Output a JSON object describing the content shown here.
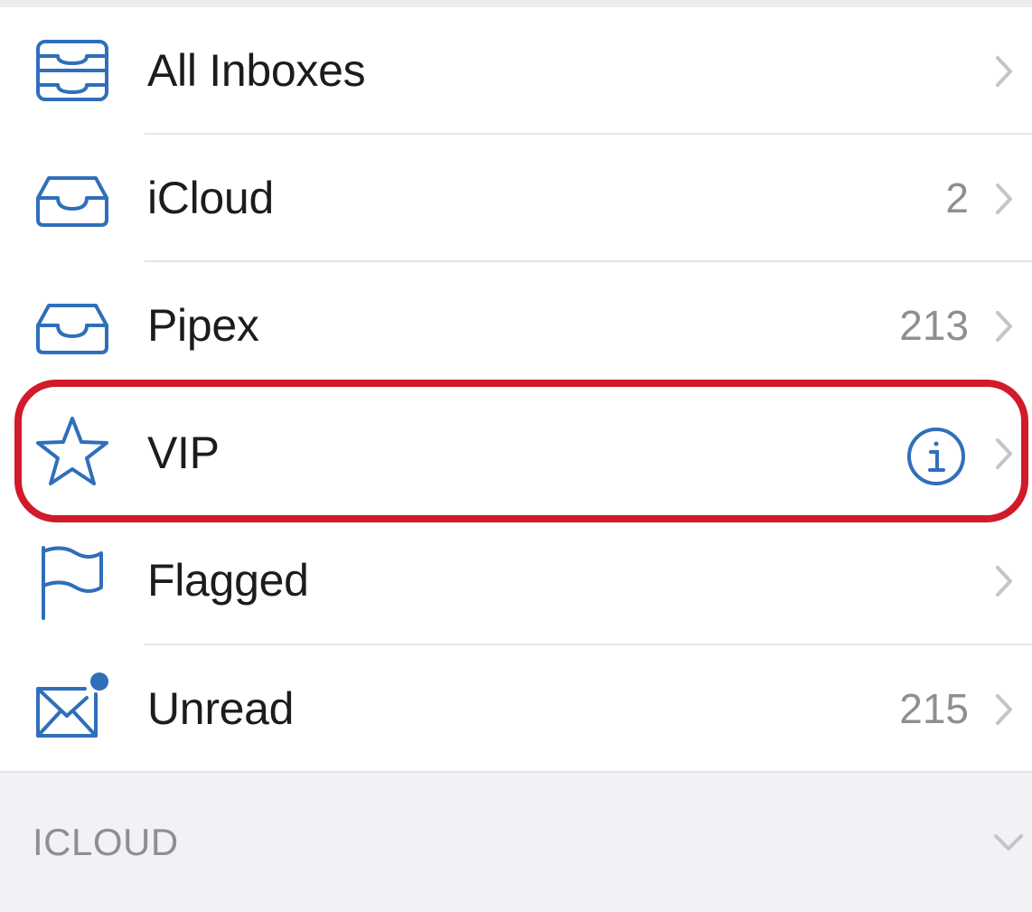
{
  "mailboxes": [
    {
      "label": "All Inboxes",
      "count": "",
      "icon": "all-inboxes-icon"
    },
    {
      "label": "iCloud",
      "count": "2",
      "icon": "inbox-tray-icon"
    },
    {
      "label": "Pipex",
      "count": "213",
      "icon": "inbox-tray-icon"
    },
    {
      "label": "VIP",
      "count": "",
      "icon": "star-icon",
      "accessory": "info-icon",
      "highlighted": true
    },
    {
      "label": "Flagged",
      "count": "",
      "icon": "flag-icon"
    },
    {
      "label": "Unread",
      "count": "215",
      "icon": "unread-envelope-icon"
    }
  ],
  "section": {
    "title": "ICLOUD",
    "icon": "chevron-down-icon"
  },
  "colors": {
    "accent": "#2f6fba",
    "highlight": "#d11a2a",
    "text": "#1c1c1e",
    "secondary": "#8e8e93",
    "separator": "#e5e5ea",
    "groupedBackground": "#f2f2f6"
  }
}
